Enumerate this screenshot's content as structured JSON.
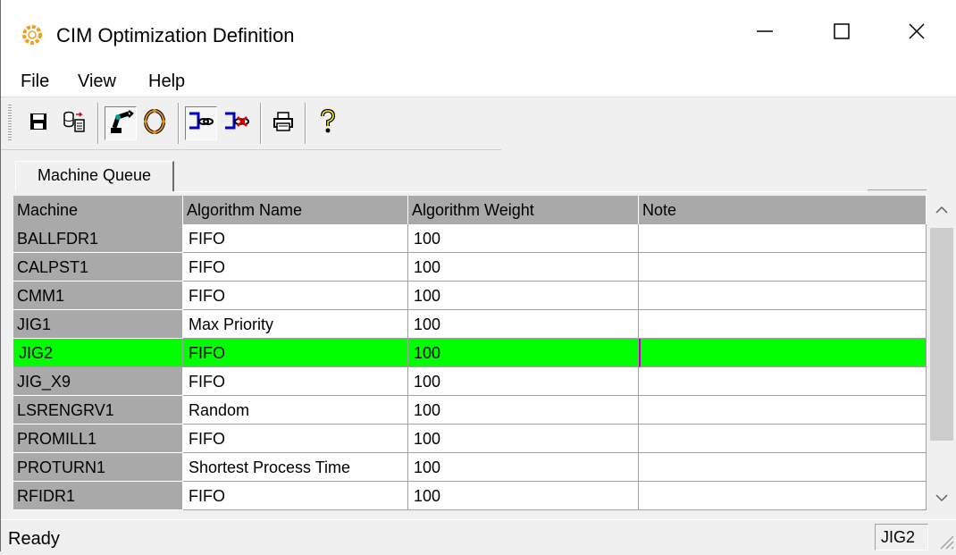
{
  "window": {
    "title": "CIM Optimization Definition",
    "icon": "cim-gear-icon",
    "minimize_icon": "minimize-icon",
    "maximize_icon": "maximize-icon",
    "close_icon": "close-icon"
  },
  "menu": {
    "items": [
      "File",
      "View",
      "Help"
    ]
  },
  "toolbar": {
    "buttons": [
      {
        "icon": "save-icon",
        "pressed": false
      },
      {
        "icon": "database-export-icon",
        "pressed": false
      },
      {
        "icon": "robot-arm-icon",
        "pressed": true
      },
      {
        "icon": "ring-optimize-icon",
        "pressed": false
      },
      {
        "icon": "link-icon",
        "pressed": true
      },
      {
        "icon": "unlink-icon",
        "pressed": false
      },
      {
        "icon": "print-icon",
        "pressed": false
      },
      {
        "icon": "help-icon",
        "pressed": false
      }
    ]
  },
  "tabs": [
    {
      "label": "Machine Queue",
      "active": true
    }
  ],
  "grid": {
    "columns": [
      "Machine",
      "Algorithm Name",
      "Algorithm Weight",
      "Note"
    ],
    "rows": [
      {
        "machine": "BALLFDR1",
        "algorithm": "FIFO",
        "weight": "100",
        "note": ""
      },
      {
        "machine": "CALPST1",
        "algorithm": "FIFO",
        "weight": "100",
        "note": ""
      },
      {
        "machine": "CMM1",
        "algorithm": "FIFO",
        "weight": "100",
        "note": ""
      },
      {
        "machine": "JIG1",
        "algorithm": "Max Priority",
        "weight": "100",
        "note": ""
      },
      {
        "machine": "JIG2",
        "algorithm": "FIFO",
        "weight": "100",
        "note": "",
        "selected": true
      },
      {
        "machine": "JIG_X9",
        "algorithm": "FIFO",
        "weight": "100",
        "note": ""
      },
      {
        "machine": "LSRENGRV1",
        "algorithm": "Random",
        "weight": "100",
        "note": ""
      },
      {
        "machine": "PROMILL1",
        "algorithm": "FIFO",
        "weight": "100",
        "note": ""
      },
      {
        "machine": "PROTURN1",
        "algorithm": "Shortest Process Time",
        "weight": "100",
        "note": ""
      },
      {
        "machine": "RFIDR1",
        "algorithm": "FIFO",
        "weight": "100",
        "note": ""
      }
    ],
    "selected_color": "#00ff00",
    "header_color": "#a9a9a9"
  },
  "status": {
    "text": "Ready",
    "pane": "JIG2"
  }
}
